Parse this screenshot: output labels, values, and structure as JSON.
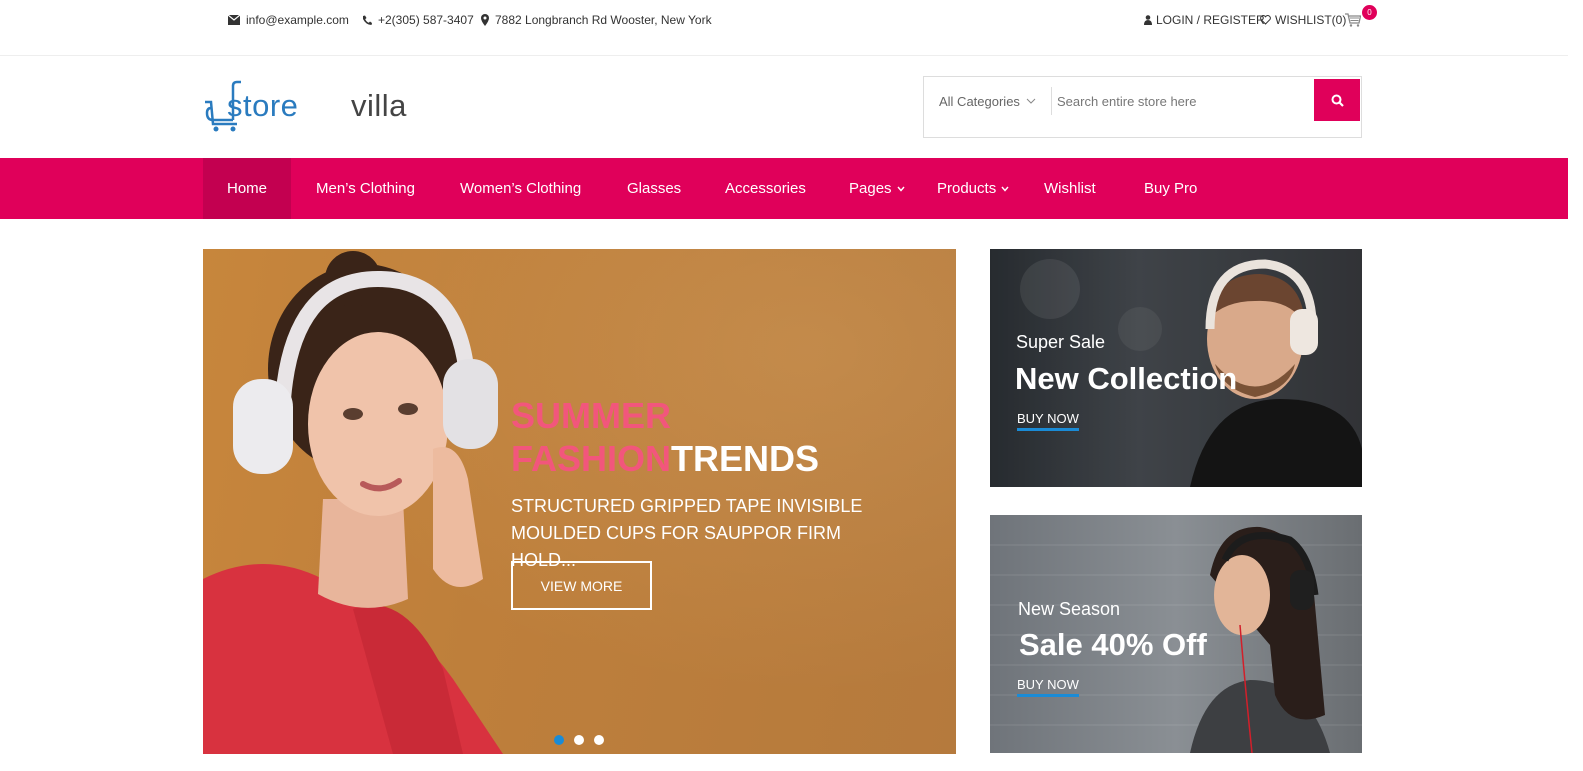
{
  "topbar": {
    "email": "info@example.com",
    "phone": "+2(305) 587-3407",
    "address": "7882 Longbranch Rd Wooster, New York",
    "login_label": "LOGIN / REGISTER",
    "wishlist_label": "WISHLIST(0)",
    "cart_count": "0"
  },
  "header": {
    "logo_part1": "store",
    "logo_part2": "villa",
    "category_label": "All Categories",
    "search_placeholder": "Search entire store here"
  },
  "nav": {
    "items": [
      {
        "label": "Home"
      },
      {
        "label": "Men’s Clothing"
      },
      {
        "label": "Women’s Clothing"
      },
      {
        "label": "Glasses"
      },
      {
        "label": "Accessories"
      },
      {
        "label": "Pages"
      },
      {
        "label": "Products"
      },
      {
        "label": "Wishlist"
      },
      {
        "label": "Buy Pro"
      }
    ]
  },
  "hero": {
    "title_pink_1": "SUMMER",
    "title_pink_2": "FASHION",
    "title_white": "TRENDS",
    "subtitle": "STRUCTURED GRIPPED TAPE INVISIBLE MOULDED CUPS FOR SAUPPOR FIRM HOLD...",
    "button_label": "VIEW MORE",
    "slide_count": 3,
    "active_slide": 1
  },
  "banners": [
    {
      "kicker": "Super Sale",
      "headline": "New Collection",
      "link": "BUY NOW"
    },
    {
      "kicker": "New Season",
      "headline": "Sale 40% Off",
      "link": "BUY NOW"
    }
  ],
  "colors": {
    "brand": "#e0005a",
    "brand_dark": "#c30050",
    "accent_blue": "#1a8bd6",
    "logo_blue": "#2a7bbf",
    "hero_pink": "#f2567c"
  },
  "icons": [
    "envelope-icon",
    "phone-icon",
    "map-marker-icon",
    "user-icon",
    "heart-icon",
    "cart-icon",
    "chevron-down-icon",
    "search-icon"
  ]
}
